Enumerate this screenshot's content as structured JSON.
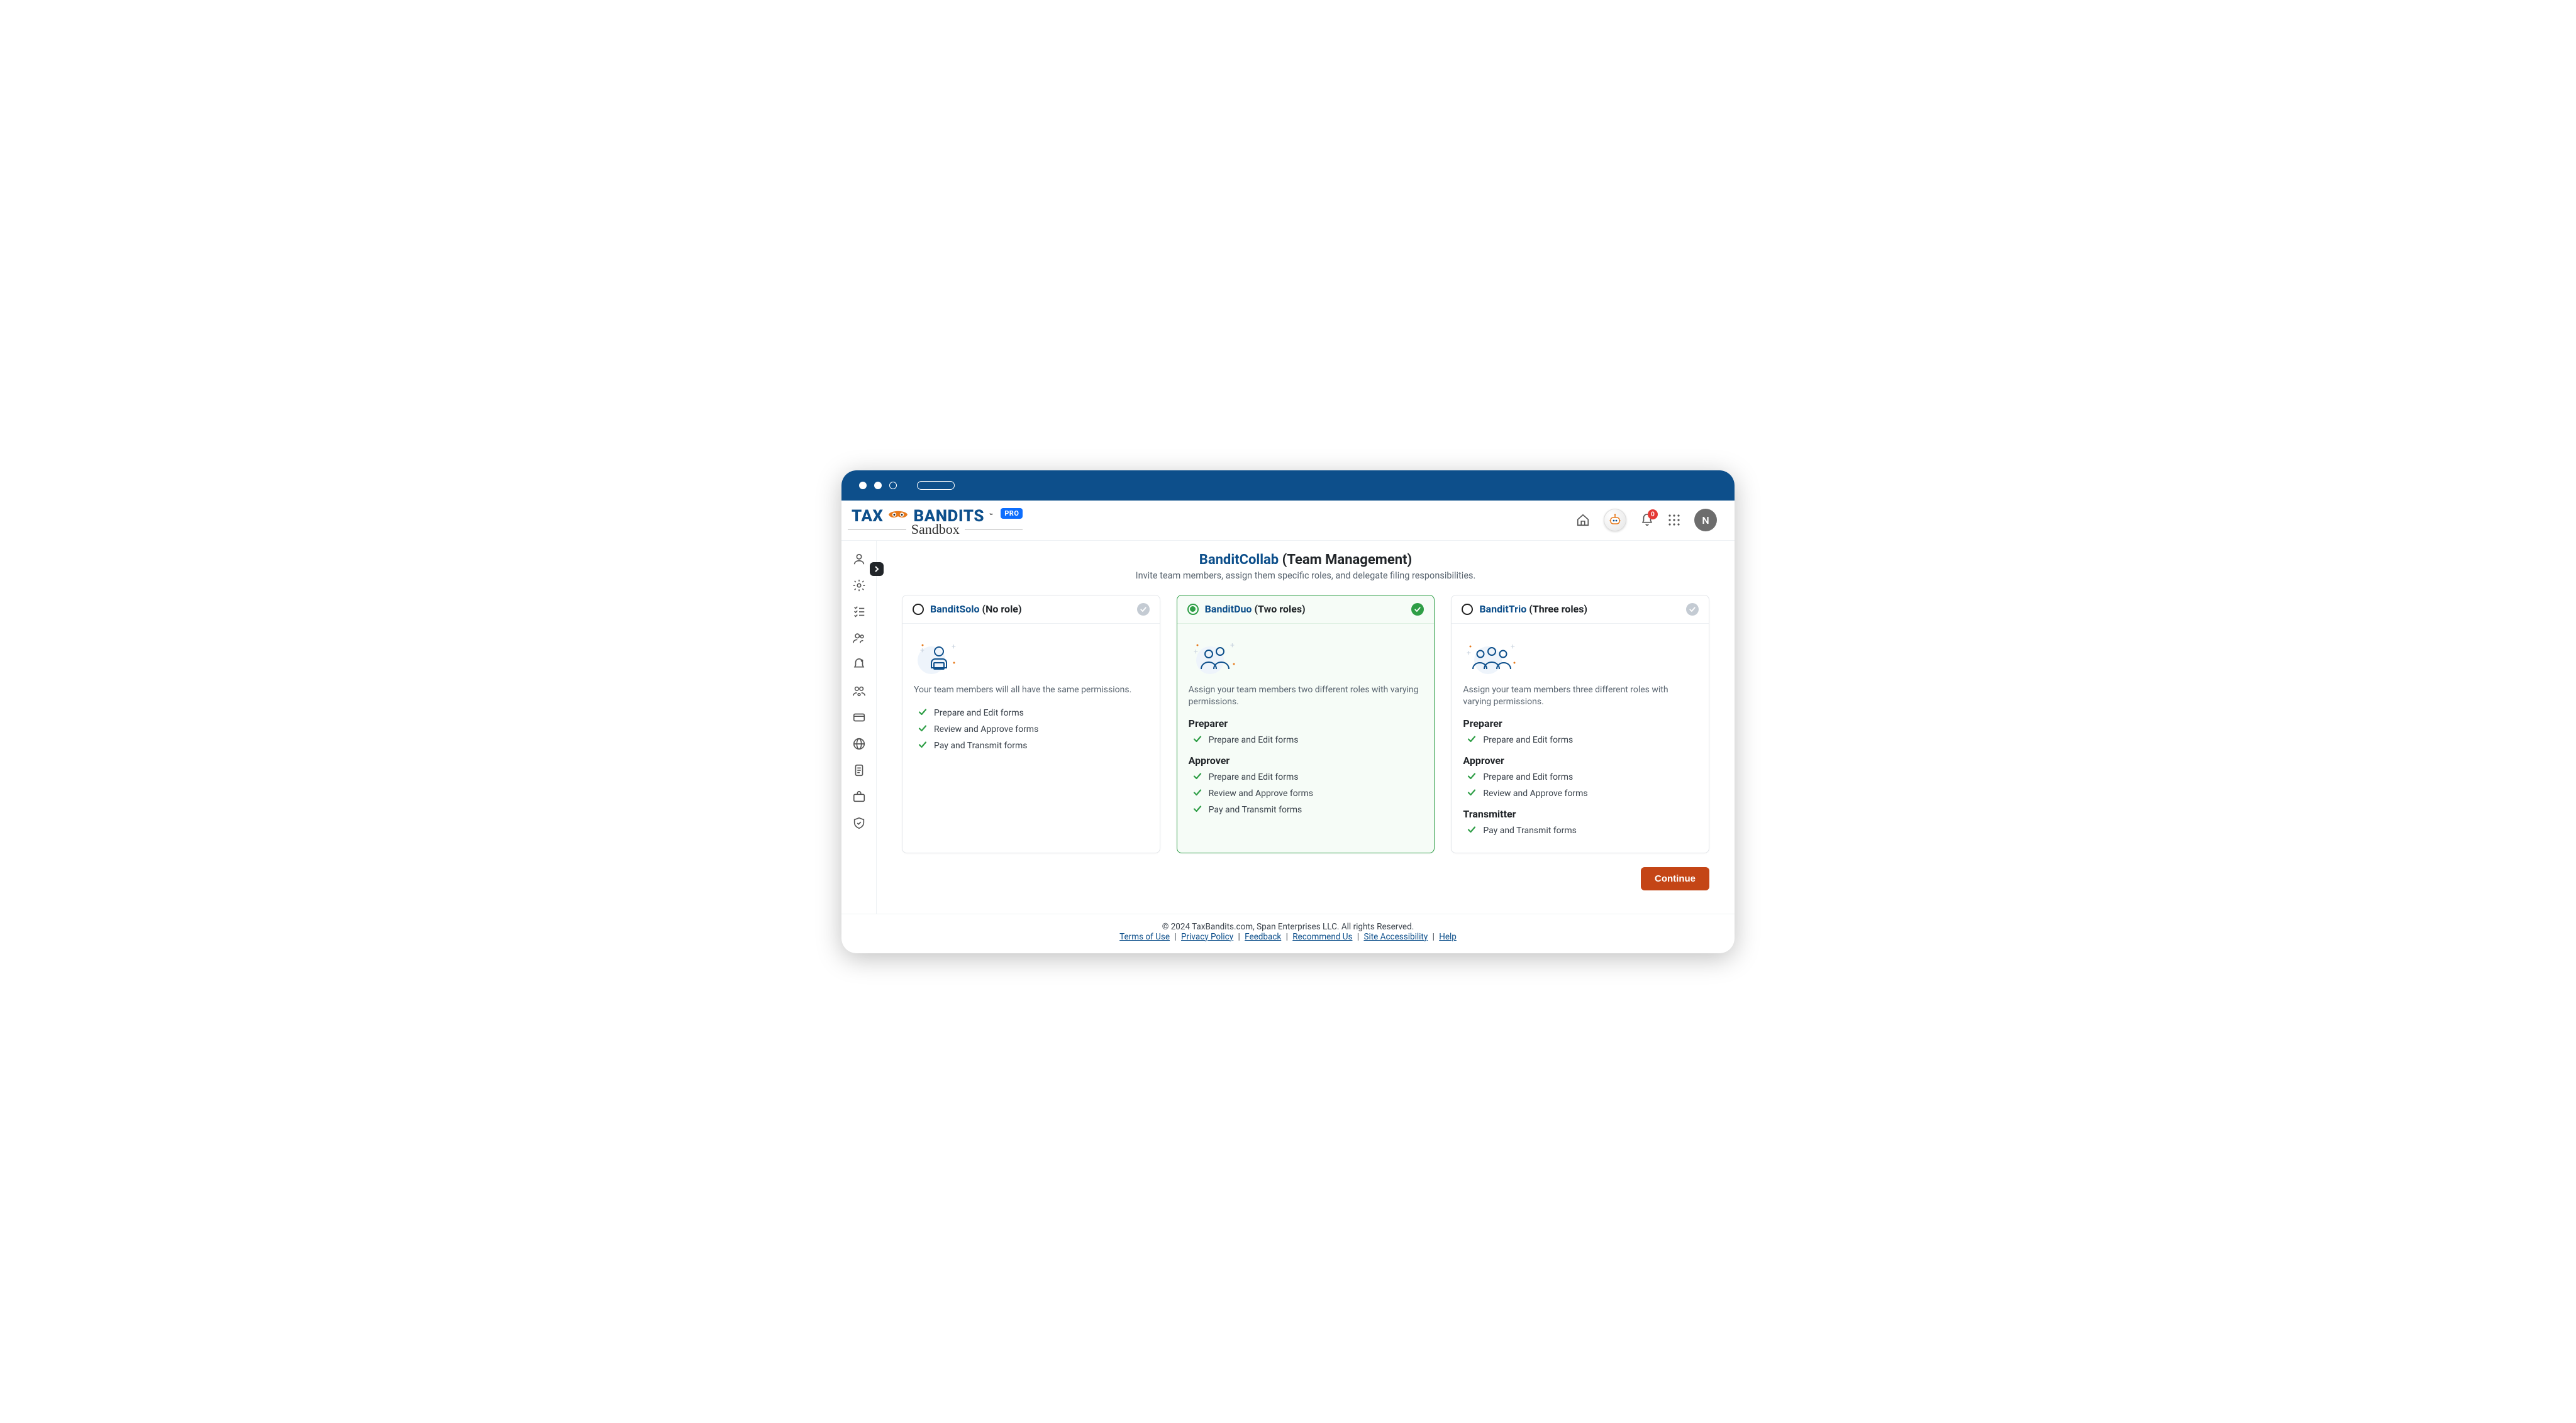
{
  "header": {
    "logo_text_left": "TAX",
    "logo_text_right": "BANDITS",
    "logo_tm": "™",
    "logo_pro": "PRO",
    "logo_sub": "Sandbox",
    "notifications_count": "0",
    "avatar_initial": "N"
  },
  "page": {
    "title_brand": "BanditCollab ",
    "title_rest": "(Team Management)",
    "subtitle": "Invite team members, assign them specific roles, and delegate filing responsibilities."
  },
  "cards": [
    {
      "name": "BanditSolo ",
      "roles_label": "(No role)",
      "selected": false,
      "desc": "Your team members will all have the same permissions.",
      "sections": [
        {
          "role": null,
          "items": [
            "Prepare and Edit forms",
            "Review and Approve forms",
            "Pay and Transmit forms"
          ]
        }
      ]
    },
    {
      "name": "BanditDuo ",
      "roles_label": "(Two roles)",
      "selected": true,
      "desc": "Assign your team members two different roles with varying permissions.",
      "sections": [
        {
          "role": "Preparer",
          "items": [
            "Prepare and Edit forms"
          ]
        },
        {
          "role": "Approver",
          "items": [
            "Prepare and Edit forms",
            "Review and Approve forms",
            "Pay and Transmit forms"
          ]
        }
      ]
    },
    {
      "name": "BanditTrio ",
      "roles_label": "(Three roles)",
      "selected": false,
      "desc": "Assign your team members three different roles with varying permissions.",
      "sections": [
        {
          "role": "Preparer",
          "items": [
            "Prepare and Edit forms"
          ]
        },
        {
          "role": "Approver",
          "items": [
            "Prepare and Edit forms",
            "Review and Approve forms"
          ]
        },
        {
          "role": "Transmitter",
          "items": [
            "Pay and Transmit forms"
          ]
        }
      ]
    }
  ],
  "actions": {
    "continue": "Continue"
  },
  "footer": {
    "copyright": "© 2024 TaxBandits.com, Span Enterprises LLC. All rights Reserved.",
    "links": [
      "Terms of Use",
      "Privacy Policy",
      "Feedback",
      "Recommend Us",
      "Site Accessibility",
      "Help"
    ]
  }
}
